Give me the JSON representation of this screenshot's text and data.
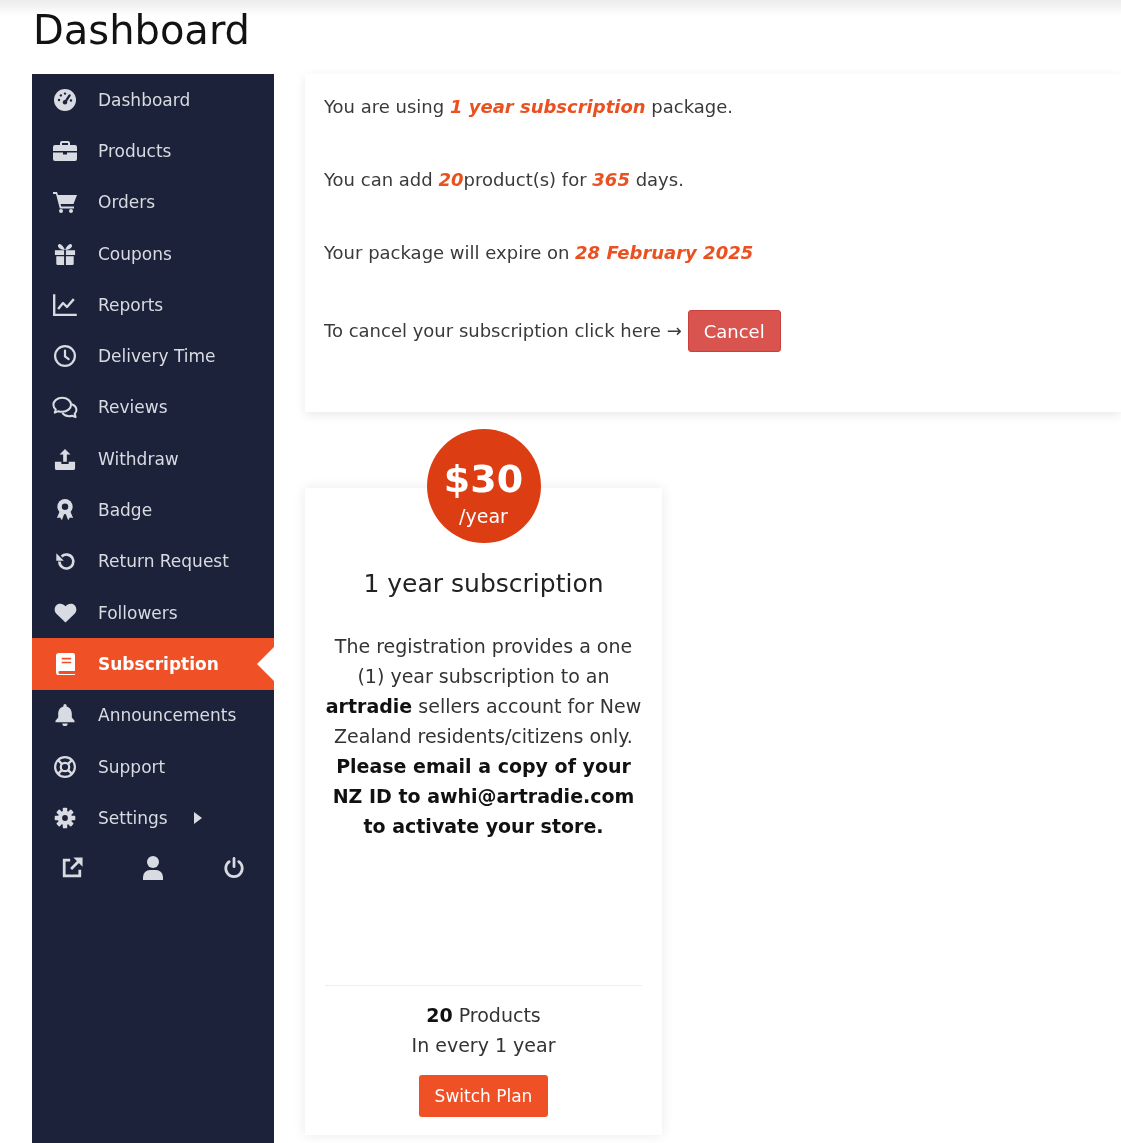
{
  "page_title": "Dashboard",
  "sidebar": {
    "items": [
      {
        "label": "Dashboard",
        "kind": "link",
        "selected": false
      },
      {
        "label": "Products",
        "kind": "link",
        "selected": false
      },
      {
        "label": "Orders",
        "kind": "link",
        "selected": false
      },
      {
        "label": "Coupons",
        "kind": "link",
        "selected": false
      },
      {
        "label": "Reports",
        "kind": "link",
        "selected": false
      },
      {
        "label": "Delivery Time",
        "kind": "link",
        "selected": false
      },
      {
        "label": "Reviews",
        "kind": "link",
        "selected": false
      },
      {
        "label": "Withdraw",
        "kind": "link",
        "selected": false
      },
      {
        "label": "Badge",
        "kind": "link",
        "selected": false
      },
      {
        "label": "Return Request",
        "kind": "link",
        "selected": false
      },
      {
        "label": "Followers",
        "kind": "link",
        "selected": false
      },
      {
        "label": "Subscription",
        "kind": "link",
        "selected": true
      },
      {
        "label": "Announcements",
        "kind": "link",
        "selected": false
      },
      {
        "label": "Support",
        "kind": "link",
        "selected": false
      },
      {
        "label": "Settings",
        "kind": "submenu",
        "selected": false
      }
    ]
  },
  "subscription_summary": {
    "lines": [
      "You are using **1 year subscription** package.",
      "You can add **20**product(s) for **365** days.",
      "Your package will expire on **28 February 2025**"
    ],
    "cancel_prompt": "To cancel your subscription click here →",
    "cancel_button": "Cancel"
  },
  "plan": {
    "price": "$30",
    "period": "/year",
    "title": "1 year subscription",
    "description": "The registration provides a one (1) year subscription to an **artradie** sellers account for New Zealand residents/citizens only. **Please email a copy of your NZ ID to awhi@artradie.com to activate your store.**",
    "products": "**20** Products",
    "interval": "In every 1 year",
    "button": "Switch Plan"
  }
}
